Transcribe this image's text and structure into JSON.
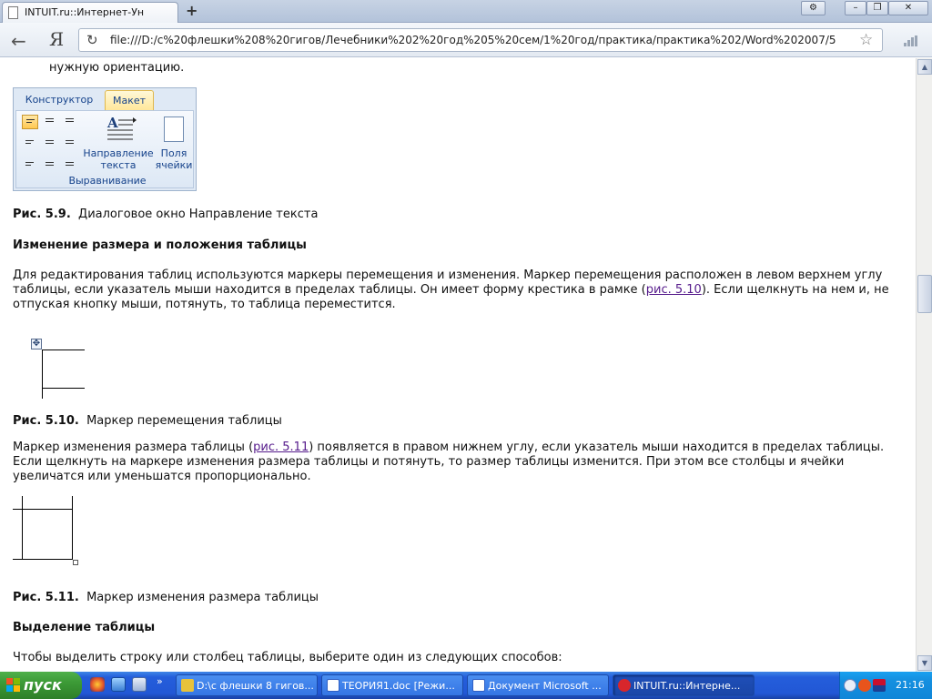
{
  "browser": {
    "tab_title": "INTUIT.ru::Интернет-Ун",
    "new_tab_symbol": "+",
    "window_buttons": {
      "settings": "⚙",
      "minimize": "–",
      "maximize": "❐",
      "close": "✕"
    },
    "back_symbol": "←",
    "logo": "Я",
    "url": "file:///D:/c%20флешки%208%20гигов/Лечебники%202%20год%205%20сем/1%20год/практика/практика%202/Word%202007/5",
    "reload_symbol": "↻",
    "star_symbol": "☆"
  },
  "content": {
    "top_line": "нужную ориентацию.",
    "ribbon": {
      "tabs": [
        "Конструктор",
        "Макет"
      ],
      "active_tab": "Макет",
      "text_direction_label_1": "Направление",
      "text_direction_label_2": "текста",
      "cell_margins_label_1": "Поля",
      "cell_margins_label_2": "ячейки",
      "group_label": "Выравнивание"
    },
    "fig_5_9": {
      "number": "Рис. 5.9.",
      "caption": "Диалоговое окно Направление текста"
    },
    "heading_resize": "Изменение размера и положения таблицы",
    "para1": {
      "line1": "Для редактирования таблиц используются маркеры перемещения и изменения. Маркер перемещения расположен в левом верхнем углу",
      "line2_before": "таблицы, если указатель мыши находится в пределах таблицы. Он имеет форму крестика в рамке (",
      "line2_link": "рис. 5.10",
      "line2_after": "). Если щелкнуть на нем и, не",
      "line3": "отпуская кнопку мыши, потянуть, то таблица переместится."
    },
    "fig_5_10": {
      "number": "Рис. 5.10.",
      "caption": "Маркер перемещения таблицы"
    },
    "para2": {
      "line1_before": "Маркер изменения размера таблицы (",
      "line1_link": "рис. 5.11",
      "line1_after": ") появляется в правом нижнем углу, если указатель мыши находится в пределах таблицы.",
      "line2": "Если щелкнуть на маркере изменения размера таблицы и потянуть, то размер таблицы изменится. При этом все столбцы и ячейки",
      "line3": "увеличатся или уменьшатся пропорционально."
    },
    "fig_5_11": {
      "number": "Рис. 5.11.",
      "caption": "Маркер изменения размера таблицы"
    },
    "heading_select": "Выделение таблицы",
    "para3": "Чтобы выделить строку или столбец таблицы, выберите один из следующих способов:"
  },
  "taskbar": {
    "start_label": "пуск",
    "tasks": [
      {
        "label": "D:\\c флешки 8 гигов...",
        "color": "#e8c23a"
      },
      {
        "label": "ТЕОРИЯ1.doc [Режи...",
        "color": "#2f5fc4"
      },
      {
        "label": "Документ Microsoft ...",
        "color": "#2f5fc4"
      },
      {
        "label": "INTUIT.ru::Интерне...",
        "color": "#d8262b"
      }
    ],
    "time": "21:16"
  },
  "colors": {
    "link": "#551a8b",
    "ribbon_accent": "#15428b",
    "taskbar": "#245edb",
    "start": "#3c9a36"
  }
}
